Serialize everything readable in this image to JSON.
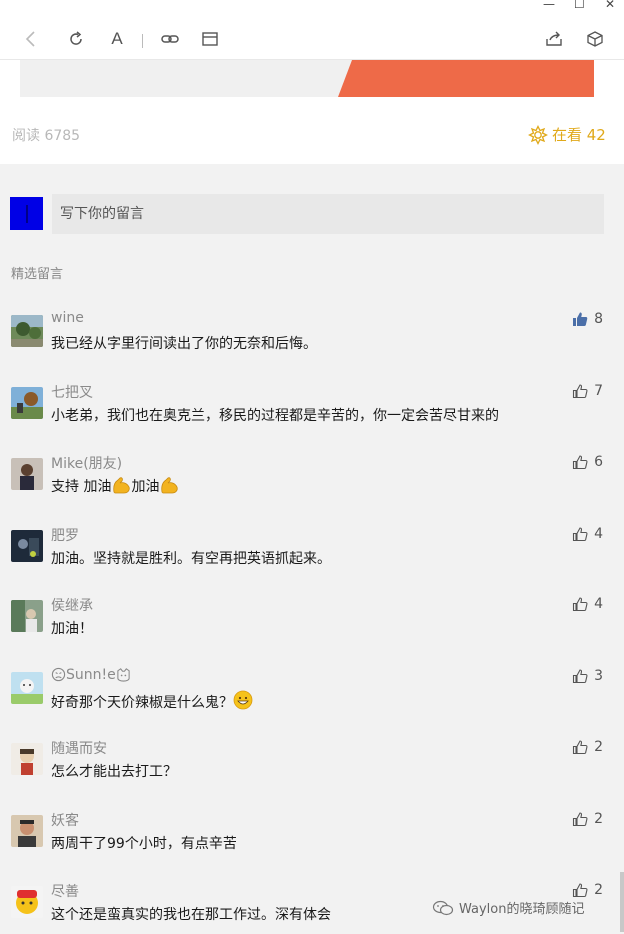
{
  "window": {
    "min_glyph": "—",
    "max_glyph": "☐",
    "close_glyph": "✕"
  },
  "toolbar": {
    "font_glyph": "A"
  },
  "article": {
    "read_count": "阅读 6785",
    "watching_label": "在看 42",
    "accent_color": "#e0a91a"
  },
  "comment_input": {
    "placeholder": "写下你的留言"
  },
  "section_title": "精选留言",
  "comments": [
    {
      "nick": "wine",
      "text": "我已经从字里行间读出了你的无奈和后悔。",
      "likes": "8",
      "liked": true
    },
    {
      "nick": "七把叉",
      "text": "小老弟，我们也在奥克兰，移民的过程都是辛苦的，你一定会苦尽甘来的",
      "likes": "7",
      "liked": false
    },
    {
      "nick": "Mike(朋友)",
      "text_a": "支持 加油",
      "text_b": "加油",
      "likes": "6",
      "liked": false
    },
    {
      "nick": "肥罗",
      "text": "加油。坚持就是胜利。有空再把英语抓起来。",
      "likes": "4",
      "liked": false
    },
    {
      "nick": "侯继承",
      "text": "加油！",
      "likes": "4",
      "liked": false
    },
    {
      "nick_core": "Sunn!e",
      "text": "好奇那个天价辣椒是什么鬼？",
      "likes": "3",
      "liked": false
    },
    {
      "nick": "随遇而安",
      "text": "怎么才能出去打工？",
      "likes": "2",
      "liked": false
    },
    {
      "nick": "妖客",
      "text": "两周干了99个小时，有点辛苦",
      "likes": "2",
      "liked": false
    },
    {
      "nick": "尽善",
      "text": "这个还是蛮真实的我也在那工作过。深有体会",
      "likes": "2",
      "liked": false
    }
  ],
  "watermark": "Waylon的晓琦顾随记"
}
